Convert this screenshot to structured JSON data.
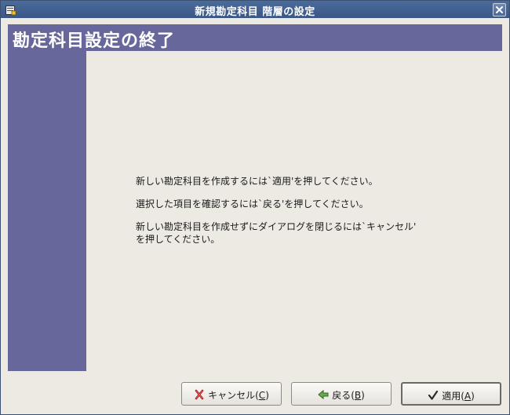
{
  "window": {
    "title": "新規勘定科目 階層の設定"
  },
  "page": {
    "heading": "勘定科目設定の終了"
  },
  "messages": [
    "新しい勘定科目を作成するには`適用'を押してください。",
    "選択した項目を確認するには`戻る'を押してください。",
    "新しい勘定科目を作成せずにダイアログを閉じるには`キャンセル'\nを押してください。"
  ],
  "buttons": {
    "cancel": {
      "label": "キャンセル(",
      "mnemonic": "C",
      "close": ")"
    },
    "back": {
      "label": "戻る(",
      "mnemonic": "B",
      "close": ")"
    },
    "apply": {
      "label": "適用(",
      "mnemonic": "A",
      "close": ")"
    }
  },
  "colors": {
    "accent": "#67679b",
    "titlebar": "#3a5786",
    "background": "#edeae4"
  }
}
